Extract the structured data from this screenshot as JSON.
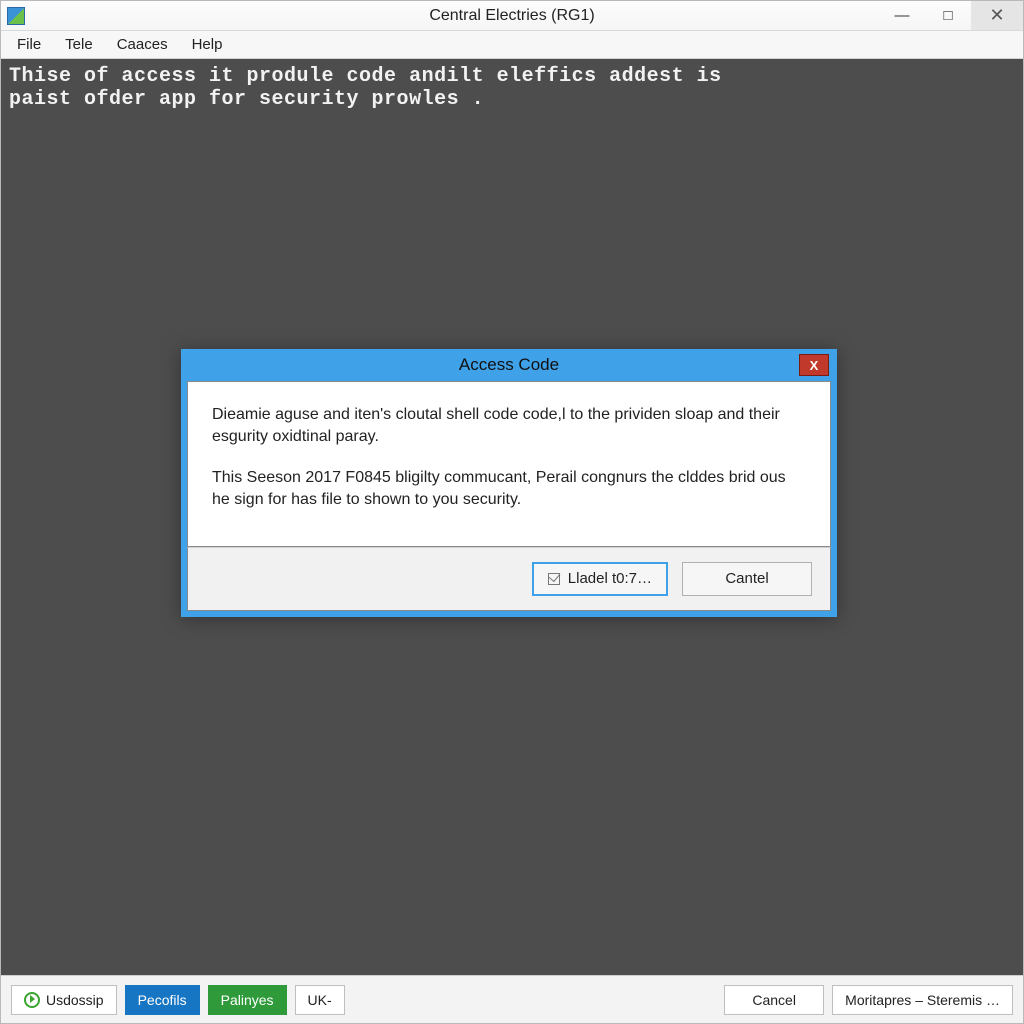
{
  "titlebar": {
    "title": "Central Electries (RG1)"
  },
  "menubar": {
    "items": [
      "File",
      "Tele",
      "Caaces",
      "Help"
    ]
  },
  "terminal": {
    "text": "Thise of access it produle code andilt eleffics addest is\npaist ofder app for security prowles ."
  },
  "dialog": {
    "title": "Access Code",
    "paragraph1": "Dieamie aguse and iten's cloutal shell code code,l to the prividen sloap and their esgurity oxidtinal paray.",
    "paragraph2": "This Seeson 2017 F0845 bligilty commucant, Perail congnurs the clddes brid ous he sign for has file to shown to you security.",
    "primary_label": "Lladel t0:7…",
    "cancel_label": "Cantel"
  },
  "bottombar": {
    "usdossip": "Usdossip",
    "pecofils": "Pecofils",
    "palinyes": "Palinyes",
    "uk": "UK-",
    "cancel": "Cancel",
    "moritapres": "Moritapres – Steremis …"
  }
}
